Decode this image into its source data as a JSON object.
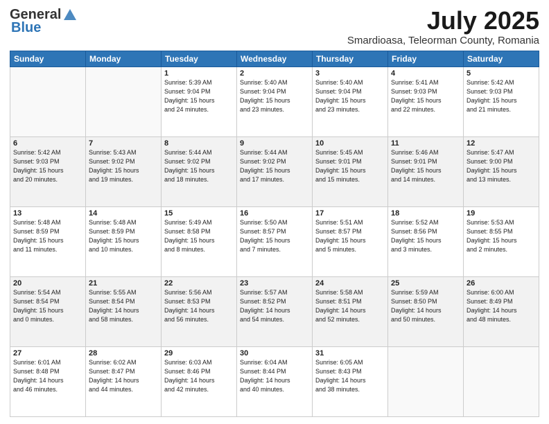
{
  "header": {
    "logo_general": "General",
    "logo_blue": "Blue",
    "month_title": "July 2025",
    "location": "Smardioasa, Teleorman County, Romania"
  },
  "weekdays": [
    "Sunday",
    "Monday",
    "Tuesday",
    "Wednesday",
    "Thursday",
    "Friday",
    "Saturday"
  ],
  "weeks": [
    [
      {
        "day": "",
        "info": ""
      },
      {
        "day": "",
        "info": ""
      },
      {
        "day": "1",
        "info": "Sunrise: 5:39 AM\nSunset: 9:04 PM\nDaylight: 15 hours\nand 24 minutes."
      },
      {
        "day": "2",
        "info": "Sunrise: 5:40 AM\nSunset: 9:04 PM\nDaylight: 15 hours\nand 23 minutes."
      },
      {
        "day": "3",
        "info": "Sunrise: 5:40 AM\nSunset: 9:04 PM\nDaylight: 15 hours\nand 23 minutes."
      },
      {
        "day": "4",
        "info": "Sunrise: 5:41 AM\nSunset: 9:03 PM\nDaylight: 15 hours\nand 22 minutes."
      },
      {
        "day": "5",
        "info": "Sunrise: 5:42 AM\nSunset: 9:03 PM\nDaylight: 15 hours\nand 21 minutes."
      }
    ],
    [
      {
        "day": "6",
        "info": "Sunrise: 5:42 AM\nSunset: 9:03 PM\nDaylight: 15 hours\nand 20 minutes."
      },
      {
        "day": "7",
        "info": "Sunrise: 5:43 AM\nSunset: 9:02 PM\nDaylight: 15 hours\nand 19 minutes."
      },
      {
        "day": "8",
        "info": "Sunrise: 5:44 AM\nSunset: 9:02 PM\nDaylight: 15 hours\nand 18 minutes."
      },
      {
        "day": "9",
        "info": "Sunrise: 5:44 AM\nSunset: 9:02 PM\nDaylight: 15 hours\nand 17 minutes."
      },
      {
        "day": "10",
        "info": "Sunrise: 5:45 AM\nSunset: 9:01 PM\nDaylight: 15 hours\nand 15 minutes."
      },
      {
        "day": "11",
        "info": "Sunrise: 5:46 AM\nSunset: 9:01 PM\nDaylight: 15 hours\nand 14 minutes."
      },
      {
        "day": "12",
        "info": "Sunrise: 5:47 AM\nSunset: 9:00 PM\nDaylight: 15 hours\nand 13 minutes."
      }
    ],
    [
      {
        "day": "13",
        "info": "Sunrise: 5:48 AM\nSunset: 8:59 PM\nDaylight: 15 hours\nand 11 minutes."
      },
      {
        "day": "14",
        "info": "Sunrise: 5:48 AM\nSunset: 8:59 PM\nDaylight: 15 hours\nand 10 minutes."
      },
      {
        "day": "15",
        "info": "Sunrise: 5:49 AM\nSunset: 8:58 PM\nDaylight: 15 hours\nand 8 minutes."
      },
      {
        "day": "16",
        "info": "Sunrise: 5:50 AM\nSunset: 8:57 PM\nDaylight: 15 hours\nand 7 minutes."
      },
      {
        "day": "17",
        "info": "Sunrise: 5:51 AM\nSunset: 8:57 PM\nDaylight: 15 hours\nand 5 minutes."
      },
      {
        "day": "18",
        "info": "Sunrise: 5:52 AM\nSunset: 8:56 PM\nDaylight: 15 hours\nand 3 minutes."
      },
      {
        "day": "19",
        "info": "Sunrise: 5:53 AM\nSunset: 8:55 PM\nDaylight: 15 hours\nand 2 minutes."
      }
    ],
    [
      {
        "day": "20",
        "info": "Sunrise: 5:54 AM\nSunset: 8:54 PM\nDaylight: 15 hours\nand 0 minutes."
      },
      {
        "day": "21",
        "info": "Sunrise: 5:55 AM\nSunset: 8:54 PM\nDaylight: 14 hours\nand 58 minutes."
      },
      {
        "day": "22",
        "info": "Sunrise: 5:56 AM\nSunset: 8:53 PM\nDaylight: 14 hours\nand 56 minutes."
      },
      {
        "day": "23",
        "info": "Sunrise: 5:57 AM\nSunset: 8:52 PM\nDaylight: 14 hours\nand 54 minutes."
      },
      {
        "day": "24",
        "info": "Sunrise: 5:58 AM\nSunset: 8:51 PM\nDaylight: 14 hours\nand 52 minutes."
      },
      {
        "day": "25",
        "info": "Sunrise: 5:59 AM\nSunset: 8:50 PM\nDaylight: 14 hours\nand 50 minutes."
      },
      {
        "day": "26",
        "info": "Sunrise: 6:00 AM\nSunset: 8:49 PM\nDaylight: 14 hours\nand 48 minutes."
      }
    ],
    [
      {
        "day": "27",
        "info": "Sunrise: 6:01 AM\nSunset: 8:48 PM\nDaylight: 14 hours\nand 46 minutes."
      },
      {
        "day": "28",
        "info": "Sunrise: 6:02 AM\nSunset: 8:47 PM\nDaylight: 14 hours\nand 44 minutes."
      },
      {
        "day": "29",
        "info": "Sunrise: 6:03 AM\nSunset: 8:46 PM\nDaylight: 14 hours\nand 42 minutes."
      },
      {
        "day": "30",
        "info": "Sunrise: 6:04 AM\nSunset: 8:44 PM\nDaylight: 14 hours\nand 40 minutes."
      },
      {
        "day": "31",
        "info": "Sunrise: 6:05 AM\nSunset: 8:43 PM\nDaylight: 14 hours\nand 38 minutes."
      },
      {
        "day": "",
        "info": ""
      },
      {
        "day": "",
        "info": ""
      }
    ]
  ]
}
